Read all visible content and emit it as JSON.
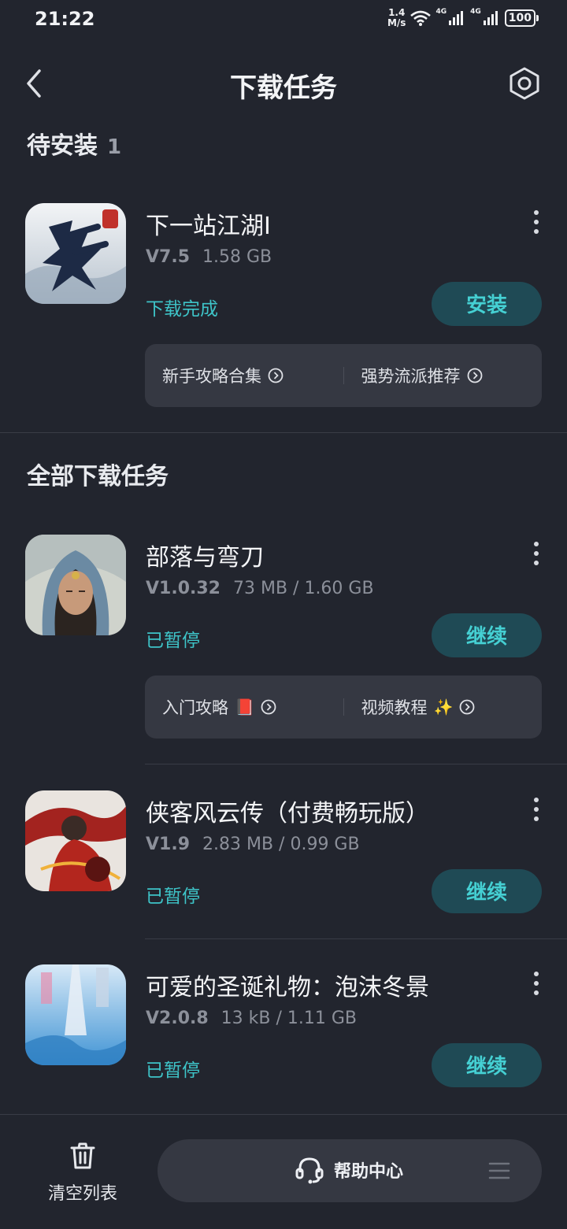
{
  "status_bar": {
    "time": "21:22",
    "net_speed_value": "1.4",
    "net_speed_unit": "M/s",
    "signal1_label": "4G",
    "signal2_label": "4G",
    "battery": "100"
  },
  "header": {
    "title": "下载任务"
  },
  "pending_section": {
    "title": "待安装",
    "count": "1"
  },
  "pending_app": {
    "name": "下一站江湖Ⅰ",
    "version": "V7.5",
    "size": "1.58 GB",
    "status": "下载完成",
    "button": "安装",
    "guide_left": "新手攻略合集",
    "guide_right": "强势流派推荐"
  },
  "all_section": {
    "title": "全部下载任务"
  },
  "apps": [
    {
      "name": "部落与弯刀",
      "version": "V1.0.32",
      "progress": "73 MB / 1.60 GB",
      "status": "已暂停",
      "button": "继续",
      "guide_left": "入门攻略",
      "guide_left_emoji": "📕",
      "guide_right": "视频教程",
      "guide_right_emoji": "✨"
    },
    {
      "name": "侠客风云传（付费畅玩版）",
      "version": "V1.9",
      "progress": "2.83 MB / 0.99 GB",
      "status": "已暂停",
      "button": "继续"
    },
    {
      "name": "可爱的圣诞礼物：泡沫冬景",
      "version": "V2.0.8",
      "progress": "13 kB / 1.11 GB",
      "status": "已暂停",
      "button": "继续"
    }
  ],
  "bottom_bar": {
    "clear_label": "清空列表",
    "help_label": "帮助中心"
  },
  "colors": {
    "background": "#22252e",
    "accent": "#3ec4c8",
    "button_bg": "#1f4a55",
    "card_bg": "#353842"
  },
  "icons": [
    "back-arrow-icon",
    "settings-hexagon-icon",
    "more-vertical-icon",
    "circle-arrow-right-icon",
    "trash-icon",
    "headset-icon",
    "menu-lines-icon",
    "wifi-icon",
    "signal-bars-icon",
    "battery-icon"
  ]
}
